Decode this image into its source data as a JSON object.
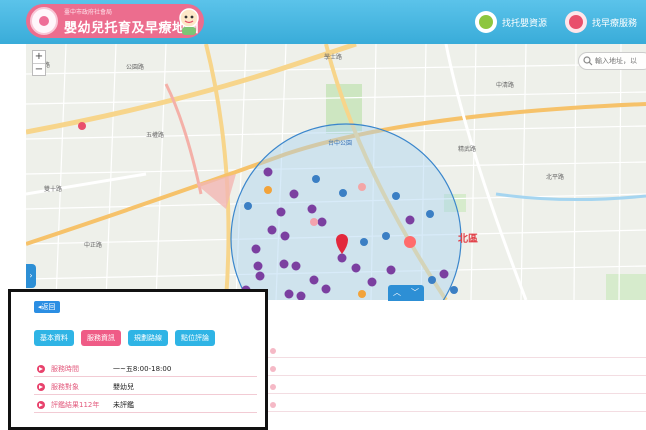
{
  "header": {
    "logo_subtitle": "臺中市政府社會局",
    "logo_title": "嬰幼兒托育及早療地圖",
    "links": [
      {
        "label": "找托嬰資源",
        "icon": "house-icon"
      },
      {
        "label": "找早療服務",
        "icon": "child-icon"
      }
    ],
    "colors": {
      "bar": "#39acd9",
      "logo": "#ec6d8e"
    }
  },
  "map": {
    "search_placeholder": "輸入地址，以",
    "zoom_in": "+",
    "zoom_out": "−",
    "district_label": "北區",
    "place_labels": [
      "中華路",
      "公園路",
      "學士路",
      "五權路",
      "中清路",
      "雙十路",
      "台中公園",
      "精武路",
      "北平路",
      "中正路"
    ],
    "radius_circle_color": "#a9d3f2"
  },
  "panel": {
    "back_label": "返回",
    "tabs": [
      {
        "label": "基本資料",
        "active": false
      },
      {
        "label": "服務資訊",
        "active": true
      },
      {
        "label": "規劃路線",
        "active": false
      },
      {
        "label": "點位評論",
        "active": false
      }
    ],
    "rows": [
      {
        "label": "服務時間",
        "value": "一~五8:00-18:00"
      },
      {
        "label": "服務對象",
        "value": "嬰幼兒"
      },
      {
        "label": "評鑑結果112年",
        "value": "未評鑑"
      }
    ],
    "colors": {
      "tab_active": "#ef5b86",
      "tab": "#2fb4e5",
      "back": "#2b8ee3"
    }
  }
}
